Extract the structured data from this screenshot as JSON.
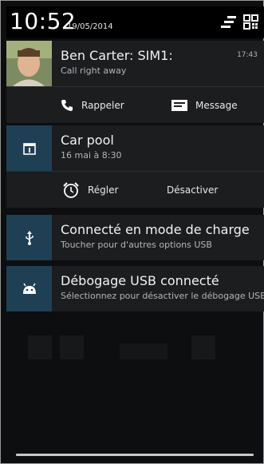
{
  "status": {
    "time": "10:52",
    "date": "19/05/2014"
  },
  "header_icons": {
    "settings": "sliders-icon",
    "quick_toggles": "grid-toggles-icon"
  },
  "notifications": [
    {
      "title": "Ben Carter: SIM1:",
      "subtitle": "Call right away",
      "time": "17:43",
      "actions": [
        {
          "label": "Rappeler",
          "icon": "phone-icon"
        },
        {
          "label": "Message",
          "icon": "message-icon"
        }
      ]
    },
    {
      "title": "Car pool",
      "subtitle": "16 mai à 8:30",
      "icon": "calendar-icon",
      "actions": [
        {
          "label": "Régler",
          "icon": "alarm-clock-icon"
        },
        {
          "label": "Désactiver"
        }
      ]
    },
    {
      "title": "Connecté en mode de charge",
      "subtitle": "Toucher pour d'autres options USB",
      "icon": "usb-icon"
    },
    {
      "title": "Débogage USB connecté",
      "subtitle": "Sélectionnez pour désactiver le débogage USB.",
      "icon": "android-icon"
    }
  ],
  "colors": {
    "icon_box": "#1f3f54",
    "card": "#1c1d1f",
    "header": "#000000"
  }
}
